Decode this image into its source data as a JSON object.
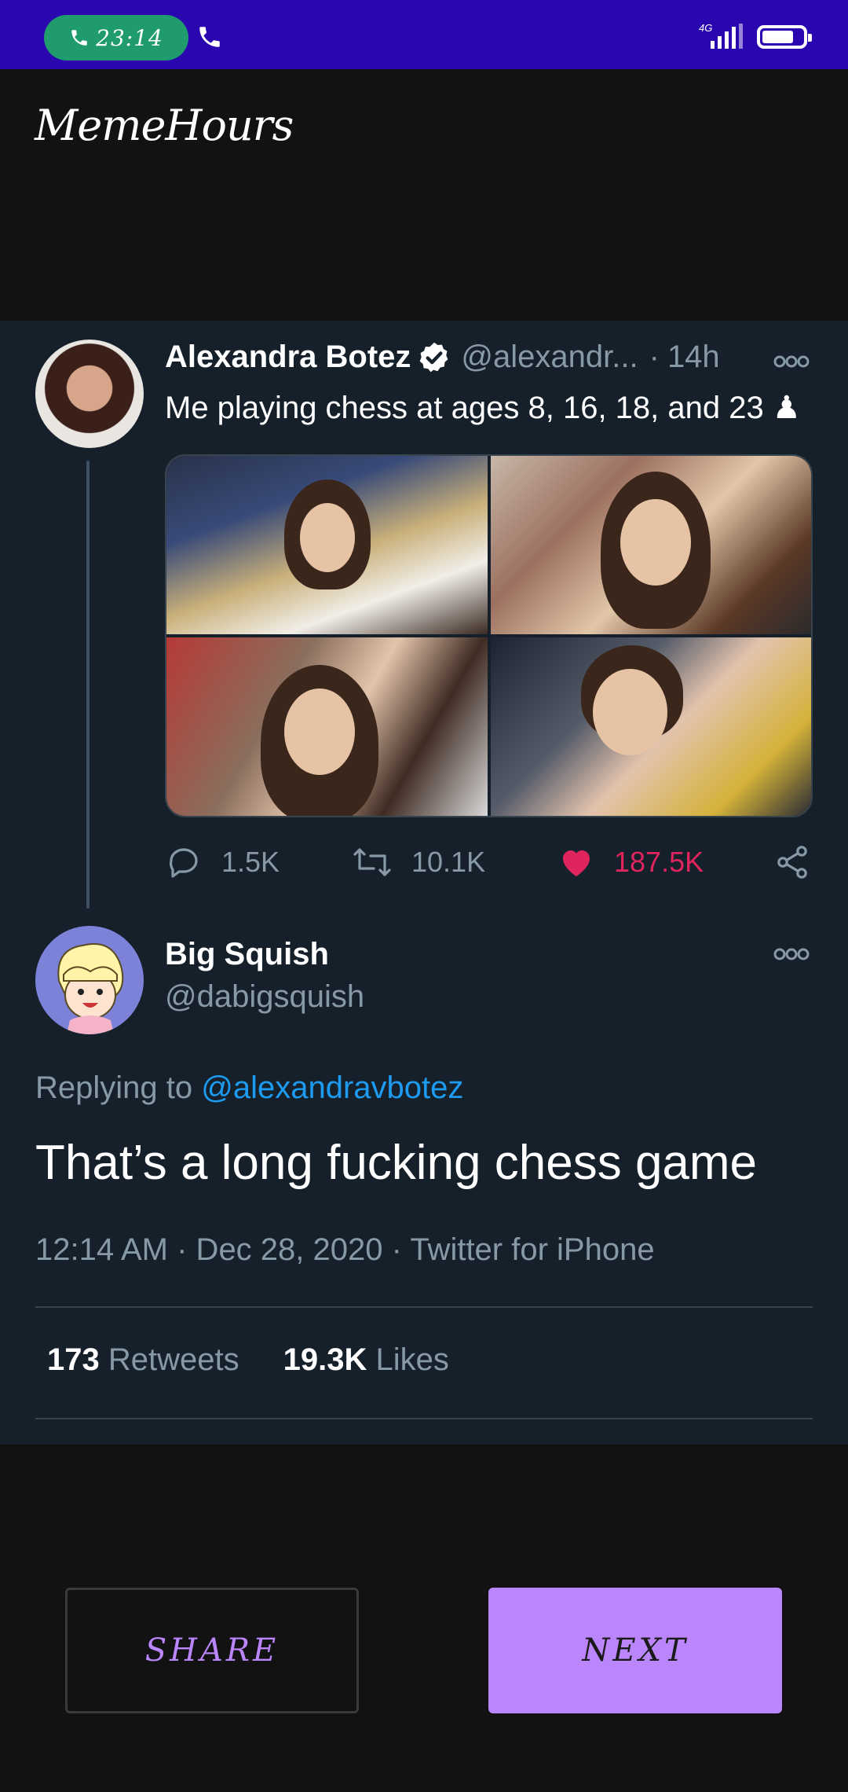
{
  "status_bar": {
    "call_time": "23:14",
    "network": "4G",
    "signal_level": 4,
    "battery_level": 0.78
  },
  "app": {
    "title": "MemeHours"
  },
  "tweet1": {
    "name": "Alexandra Botez",
    "handle": "@alexandr...",
    "dot": "·",
    "time": "14h",
    "text": "Me playing chess at ages 8, 16, 18, and 23 ♟",
    "replies": "1.5K",
    "retweets": "10.1K",
    "likes": "187.5K"
  },
  "tweet2": {
    "name": "Big Squish",
    "handle": "@dabigsquish",
    "replying_prefix": "Replying to",
    "replying_to": "@alexandravbotez",
    "text": "That’s a long fucking chess game",
    "meta": "12:14 AM · Dec 28, 2020 · Twitter for iPhone",
    "retweet_count": "173",
    "retweet_label": "Retweets",
    "like_count": "19.3K",
    "like_label": "Likes"
  },
  "buttons": {
    "share": "SHARE",
    "next": "NEXT"
  },
  "colors": {
    "status_bar": "#2a06b0",
    "call_pill": "#1f9b6e",
    "card_bg": "#15202b",
    "accent": "#bb86fc",
    "like": "#e0245e",
    "link": "#1d9bf0"
  }
}
